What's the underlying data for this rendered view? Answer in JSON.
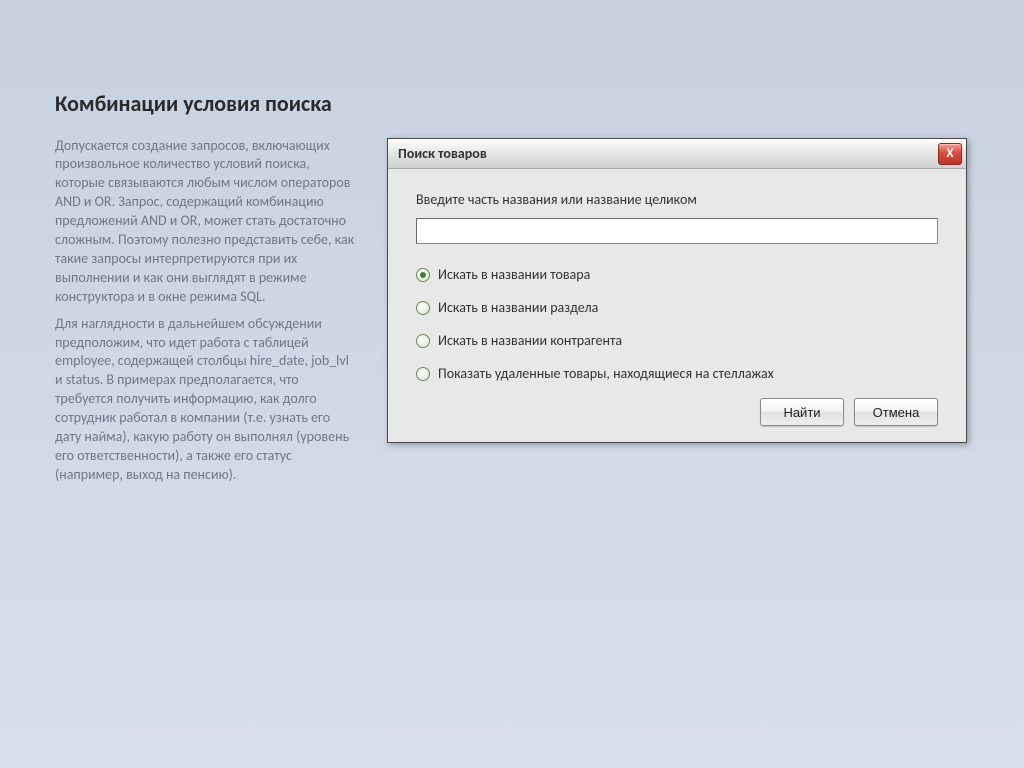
{
  "heading": "Комбинации условия поиска",
  "para1": "Допускается создание запросов, включающих произвольное количество условий поиска, которые связываются любым числом операторов AND и OR. Запрос, содержащий комбинацию предложений AND и OR, может стать достаточно сложным. Поэтому полезно представить себе, как такие запросы интерпретируются при их выполнении и как они выглядят в режиме конструктора и в окне режима SQL.",
  "para2": "Для наглядности в дальнейшем обсуждении предположим, что идет работа с таблицей employee, содержащей столбцы hire_date, job_lvl и status. В примерах предполагается, что требуется получить информацию, как долго сотрудник работал в компании (т.е. узнать его дату найма), какую работу он выполнял (уровень его ответственности), а также его статус (например, выход на пенсию).",
  "dialog": {
    "title": "Поиск товаров",
    "close": "X",
    "prompt": "Введите часть названия или название целиком",
    "input_value": "",
    "radios": [
      {
        "label": "Искать в названии товара",
        "checked": true
      },
      {
        "label": "Искать в названии раздела",
        "checked": false
      },
      {
        "label": "Искать в названии контрагента",
        "checked": false
      },
      {
        "label": "Показать удаленные товары, находящиеся на стеллажах",
        "checked": false
      }
    ],
    "find": "Найти",
    "cancel": "Отмена"
  }
}
